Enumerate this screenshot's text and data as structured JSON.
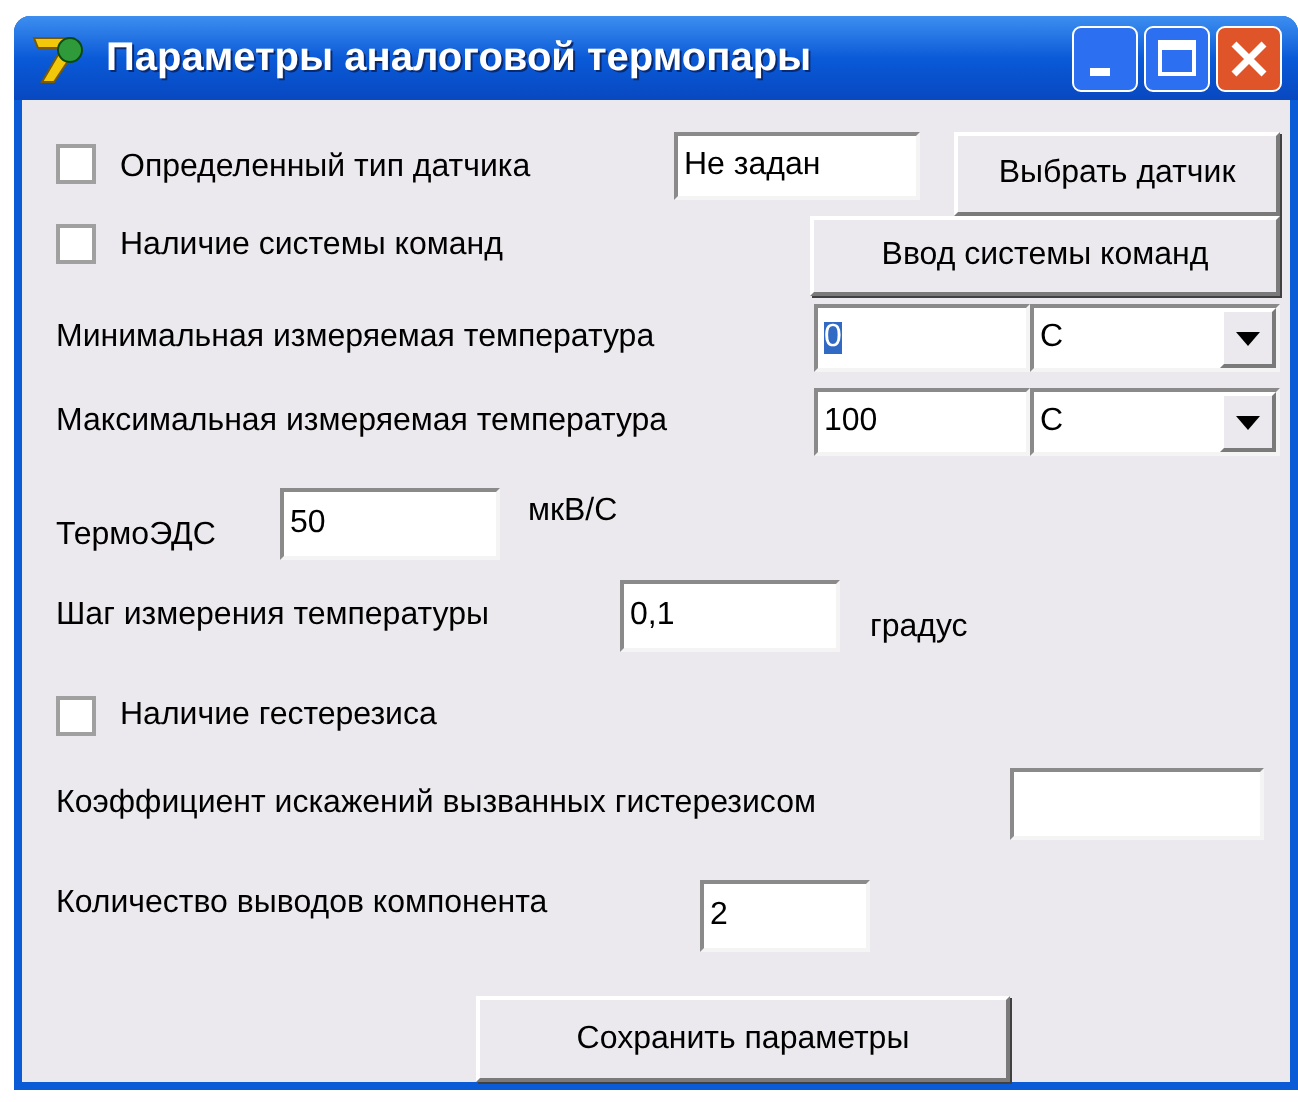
{
  "window": {
    "title": "Параметры аналоговой термопары"
  },
  "sensor_type": {
    "checkbox": {
      "label": "Определенный тип датчика",
      "checked": false
    },
    "value": "Не задан",
    "button": "Выбрать датчик"
  },
  "command_system": {
    "checkbox": {
      "label": "Наличие системы команд",
      "checked": false
    },
    "button": "Ввод системы команд"
  },
  "min_temperature": {
    "label": "Минимальная измеряемая температура",
    "value": "0",
    "text_selected": true,
    "unit": "C"
  },
  "max_temperature": {
    "label": "Максимальная измеряемая температура",
    "value": "100",
    "text_selected": false,
    "unit": "C"
  },
  "thermo_emf": {
    "label": "ТермоЭДС",
    "value": "50",
    "unit": "мкВ/С"
  },
  "measurement_step": {
    "label": "Шаг измерения температуры",
    "value": "0,1",
    "unit": "градус"
  },
  "hysteresis": {
    "label": "Наличие гестерезиса",
    "checked": false
  },
  "distortion_coefficient": {
    "label": "Коэффициент искажений вызванных гистерезисом"
  },
  "pin_count": {
    "label": "Количество выводов компонента",
    "value": "2"
  },
  "save_button": "Сохранить параметры"
}
